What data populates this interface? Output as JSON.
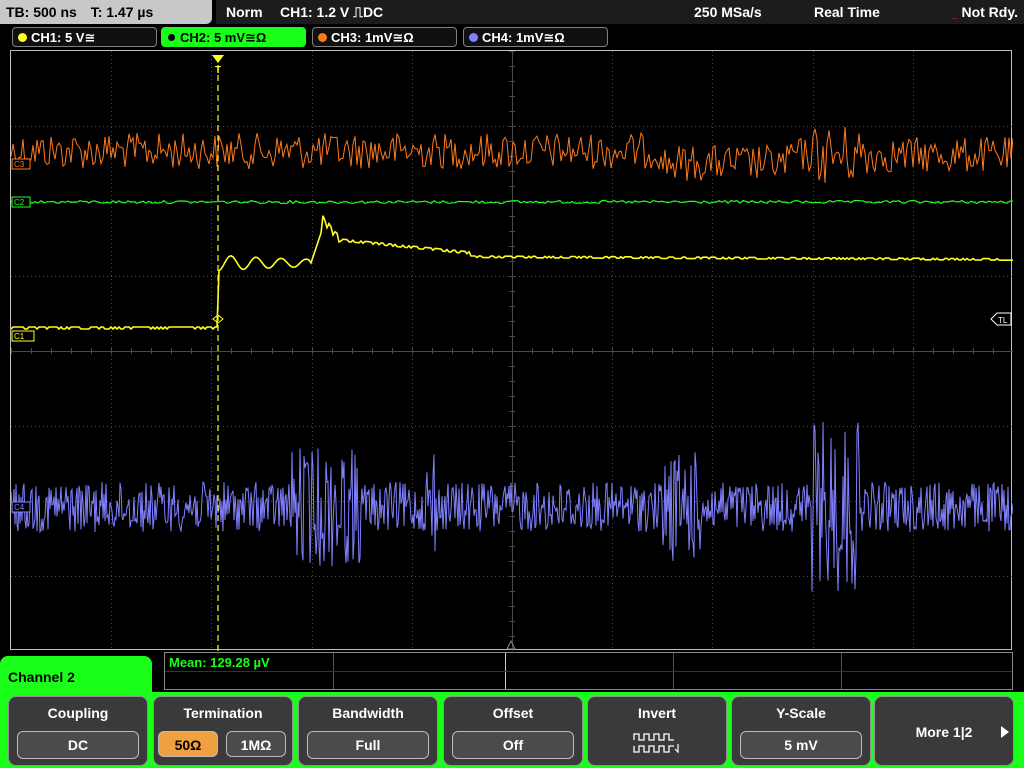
{
  "status": {
    "tb": "TB: 500 ns",
    "t": "T: 1.47 µs",
    "mode": "Norm",
    "trigger": "CH1: 1.2 V ⎍DC",
    "sample_rate": "250 MSa/s",
    "acq_mode": "Real Time",
    "state": "Not Rdy."
  },
  "channel_tabs": [
    {
      "label": "CH1: 5 V≅",
      "color": "#ffff20",
      "active": false
    },
    {
      "label": "CH2: 5 mV≅Ω",
      "color": "#20ff20",
      "active": true
    },
    {
      "label": "CH3: 1mV≅Ω",
      "color": "#ff7a1a",
      "active": false
    },
    {
      "label": "CH4: 1mV≅Ω",
      "color": "#8080ff",
      "active": false
    }
  ],
  "markers": {
    "ch3": "C3",
    "ch2": "C2",
    "ch1": "C1",
    "ch4": "C4",
    "trigger_level": "TL",
    "trigger_top": "T"
  },
  "measurement": {
    "mean": "Mean: 129.28 µV"
  },
  "menu": {
    "title": "Channel 2",
    "coupling_label": "Coupling",
    "coupling_value": "DC",
    "termination_label": "Termination",
    "termination_opt1": "50Ω",
    "termination_opt2": "1MΩ",
    "bandwidth_label": "Bandwidth",
    "bandwidth_value": "Full",
    "offset_label": "Offset",
    "offset_value": "Off",
    "invert_label": "Invert",
    "yscale_label": "Y-Scale",
    "yscale_value": "5 mV",
    "more_label": "More 1|2"
  },
  "colors": {
    "ch1": "#ffff20",
    "ch2": "#20ff20",
    "ch3": "#ff7a1a",
    "ch4": "#8080ff",
    "grid": "#4a4a4a"
  }
}
